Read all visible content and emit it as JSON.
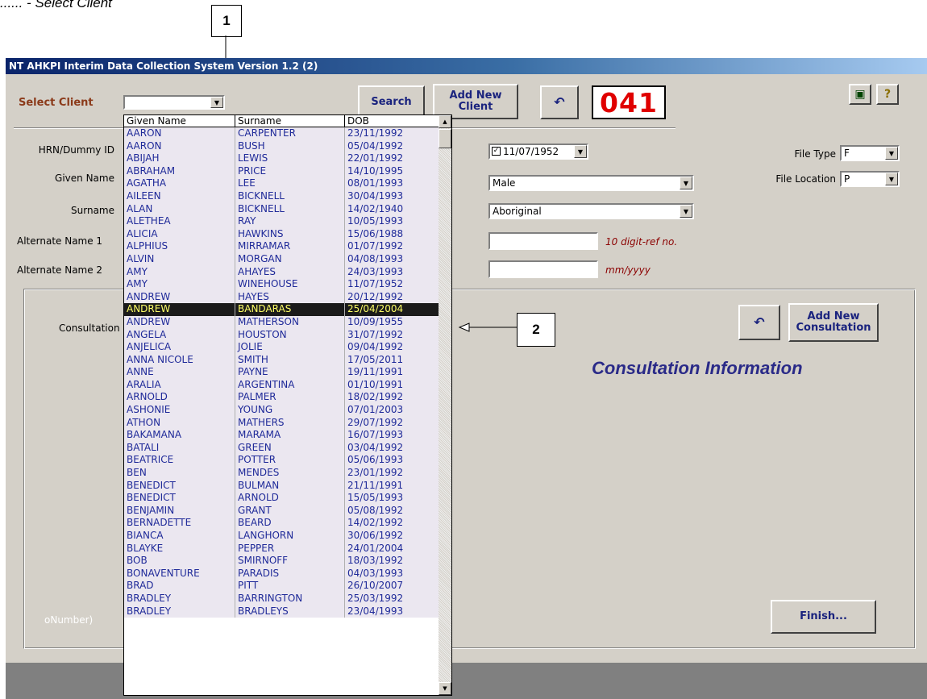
{
  "doc_caption": "...... - Select Client",
  "callouts": [
    "1",
    "2"
  ],
  "window": {
    "title": "NT AHKPI Interim Data Collection System Version 1.2 (2)"
  },
  "select_client": {
    "label": "Select Client",
    "search_label": "Search",
    "add_new_client_label": "Add New Client",
    "counter": "041"
  },
  "toolbar_icons": [
    "copy-icon",
    "help-icon"
  ],
  "labels": {
    "hrn": "HRN/Dummy ID",
    "given_name": "Given Name",
    "surname": "Surname",
    "alt1": "Alternate Name 1",
    "alt2": "Alternate Name 2",
    "consultation": "Consultation",
    "file_type": "File Type",
    "file_location": "File Location",
    "partial_number": "oNumber)"
  },
  "fields": {
    "dob": "11/07/1952",
    "gender": "Male",
    "indigenous": "Aboriginal",
    "file_type": "F",
    "file_location": "P",
    "ref_hint": "10 digit-ref no.",
    "date_hint": "mm/yyyy"
  },
  "consultation": {
    "add_new_label": "Add New Consultation",
    "title": "Consultation Information",
    "finish_label": "Finish..."
  },
  "dropdown": {
    "headers": [
      "Given Name",
      "Surname",
      "DOB"
    ],
    "selected_index": 16,
    "rows": [
      [
        "AARON",
        "CARPENTER",
        "23/11/1992"
      ],
      [
        "AARON",
        "BUSH",
        "05/04/1992"
      ],
      [
        "ABIJAH",
        "LEWIS",
        "22/01/1992"
      ],
      [
        "ABRAHAM",
        "PRICE",
        "14/10/1995"
      ],
      [
        "AGATHA",
        "LEE",
        "08/01/1993"
      ],
      [
        "AILEEN",
        "BICKNELL",
        "30/04/1993"
      ],
      [
        "ALAN",
        "BICKNELL",
        "14/02/1940"
      ],
      [
        "ALETHEA",
        "RAY",
        "10/05/1993"
      ],
      [
        "ALICIA",
        "HAWKINS",
        "15/06/1988"
      ],
      [
        "ALPHIUS",
        "MIRRAMAR",
        "01/07/1992"
      ],
      [
        "ALVIN",
        "MORGAN",
        "04/08/1993"
      ],
      [
        "AMY",
        "AHAYES",
        "24/03/1993"
      ],
      [
        "AMY",
        "WINEHOUSE",
        "11/07/1952"
      ],
      [
        "ANDREW",
        "HAYES",
        "20/12/1992"
      ],
      [
        "ANDREW",
        "BANDARAS",
        "25/04/2004"
      ],
      [
        "ANDREW",
        "MATHERSON",
        "10/09/1955"
      ],
      [
        "ANGELA",
        "HOUSTON",
        "31/07/1992"
      ],
      [
        "ANJELICA",
        "JOLIE",
        "09/04/1992"
      ],
      [
        "ANNA NICOLE",
        "SMITH",
        "17/05/2011"
      ],
      [
        "ANNE",
        "PAYNE",
        "19/11/1991"
      ],
      [
        "ARALIA",
        "ARGENTINA",
        "01/10/1991"
      ],
      [
        "ARNOLD",
        "PALMER",
        "18/02/1992"
      ],
      [
        "ASHONIE",
        "YOUNG",
        "07/01/2003"
      ],
      [
        "ATHON",
        "MATHERS",
        "29/07/1992"
      ],
      [
        "BAKAMANA",
        "MARAMA",
        "16/07/1993"
      ],
      [
        "BATALI",
        "GREEN",
        "03/04/1992"
      ],
      [
        "BEATRICE",
        "POTTER",
        "05/06/1993"
      ],
      [
        "BEN",
        "MENDES",
        "23/01/1992"
      ],
      [
        "BENEDICT",
        "BULMAN",
        "21/11/1991"
      ],
      [
        "BENEDICT",
        "ARNOLD",
        "15/05/1993"
      ],
      [
        "BENJAMIN",
        "GRANT",
        "05/08/1992"
      ],
      [
        "BERNADETTE",
        "BEARD",
        "14/02/1992"
      ],
      [
        "BIANCA",
        "LANGHORN",
        "30/06/1992"
      ],
      [
        "BLAYKE",
        "PEPPER",
        "24/01/2004"
      ],
      [
        "BOB",
        "SMIRNOFF",
        "18/03/1992"
      ],
      [
        "BONAVENTURE",
        "PARADIS",
        "04/03/1993"
      ],
      [
        "BRAD",
        "PITT",
        "26/10/2007"
      ],
      [
        "BRADLEY",
        "BARRINGTON",
        "25/03/1992"
      ],
      [
        "BRADLEY",
        "BRADLEYS",
        "23/04/1993"
      ]
    ]
  }
}
